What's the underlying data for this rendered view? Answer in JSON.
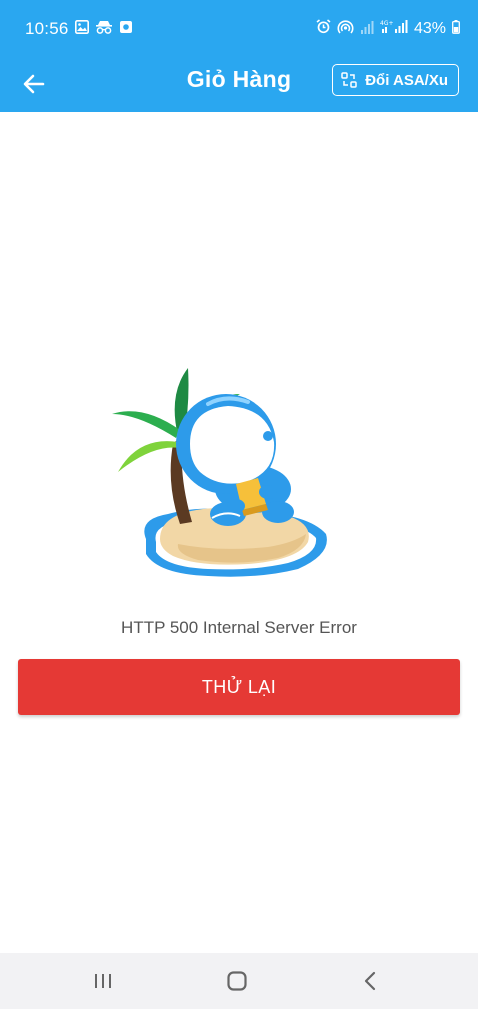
{
  "status_bar": {
    "time": "10:56",
    "battery": "43%",
    "left_icons": [
      "image-icon",
      "incognito-icon",
      "screenshot-icon"
    ],
    "right_icons": [
      "alarm-icon",
      "hotspot-icon",
      "signal-icon",
      "4g-signal-icon",
      "battery-icon"
    ]
  },
  "header": {
    "title": "Giỏ Hàng",
    "back_icon": "arrow-left-icon",
    "swap_button_label": "Đổi ASA/Xu",
    "swap_icon": "swap-icon"
  },
  "main": {
    "error_message": "HTTP 500 Internal Server Error",
    "retry_label": "THỬ LẠI",
    "illustration": "island-mascot-illustration"
  },
  "nav_bar": {
    "items": [
      "recent-apps-icon",
      "home-icon",
      "back-icon"
    ]
  },
  "colors": {
    "primary": "#2aa7f0",
    "retry": "#e53935",
    "text_muted": "#555555",
    "nav_bg": "#f2f2f4"
  }
}
